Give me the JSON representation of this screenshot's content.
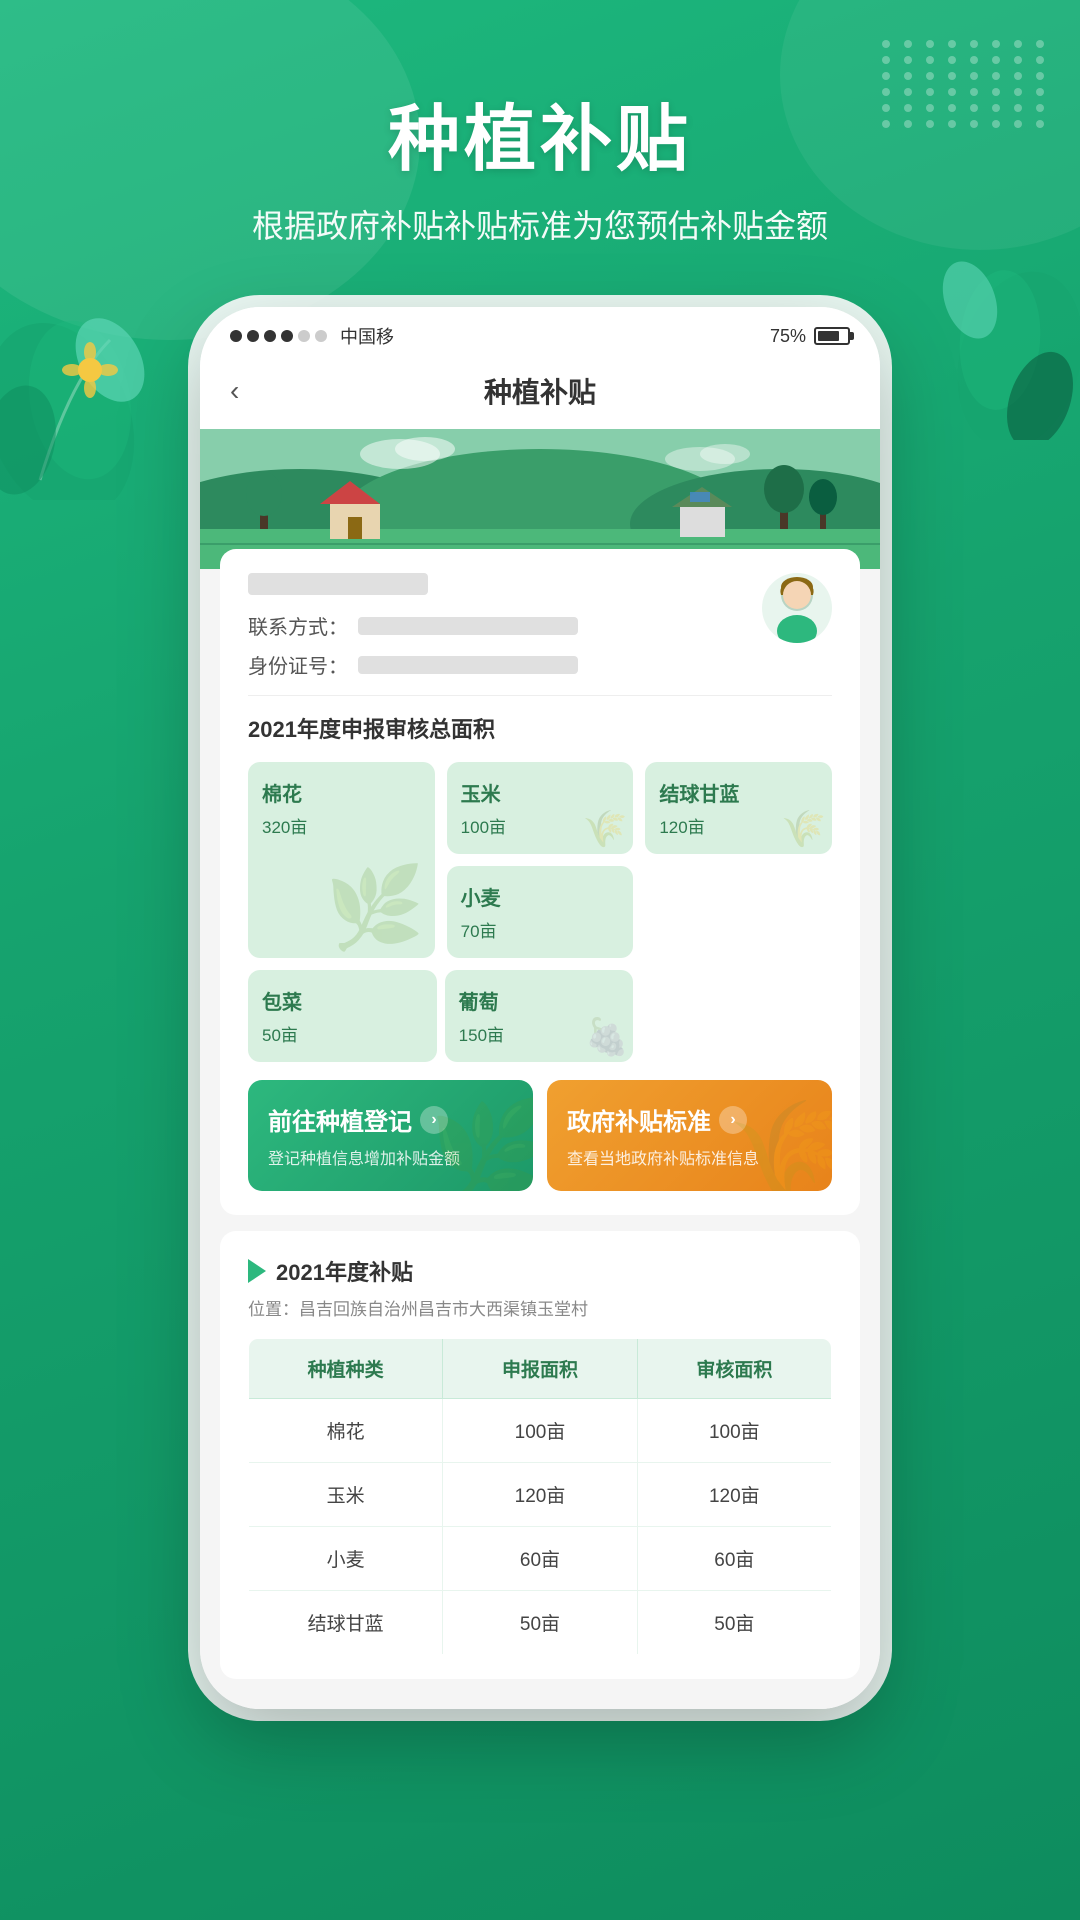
{
  "background": {
    "color": "#1db87e"
  },
  "header": {
    "main_title": "种植补贴",
    "sub_title": "根据政府补贴补贴标准为您预估补贴金额"
  },
  "status_bar": {
    "carrier": "中国移",
    "battery_percent": "75%",
    "signal_dots": [
      true,
      true,
      true,
      true,
      false,
      false
    ]
  },
  "app_header": {
    "back_label": "‹",
    "title": "种植补贴"
  },
  "user_card": {
    "contact_label": "联系方式：",
    "id_label": "身份证号："
  },
  "area_section": {
    "title": "2021年度申报审核总面积"
  },
  "crops": [
    {
      "name": "棉花",
      "area": "320亩",
      "big": true
    },
    {
      "name": "玉米",
      "area": "100亩",
      "big": false
    },
    {
      "name": "结球甘蓝",
      "area": "120亩",
      "big": false
    },
    {
      "name": "小麦",
      "area": "70亩",
      "big": false
    },
    {
      "name": "包菜",
      "area": "50亩",
      "big": false
    },
    {
      "name": "葡萄",
      "area": "150亩",
      "big": false
    }
  ],
  "action_buttons": [
    {
      "id": "register",
      "title": "前往种植登记",
      "arrow": "›",
      "desc": "登记种植信息增加补贴金额",
      "color": "green"
    },
    {
      "id": "standard",
      "title": "政府补贴标准",
      "arrow": "›",
      "desc": "查看当地政府补贴标准信息",
      "color": "orange"
    }
  ],
  "subsidy_section": {
    "title": "2021年度补贴",
    "location_prefix": "位置：",
    "location": "昌吉回族自治州昌吉市大西渠镇玉堂村",
    "table": {
      "headers": [
        "种植种类",
        "申报面积",
        "审核面积"
      ],
      "rows": [
        [
          "棉花",
          "100亩",
          "100亩"
        ],
        [
          "玉米",
          "120亩",
          "120亩"
        ],
        [
          "小麦",
          "60亩",
          "60亩"
        ],
        [
          "结球甘蓝",
          "50亩",
          "50亩"
        ]
      ]
    }
  }
}
